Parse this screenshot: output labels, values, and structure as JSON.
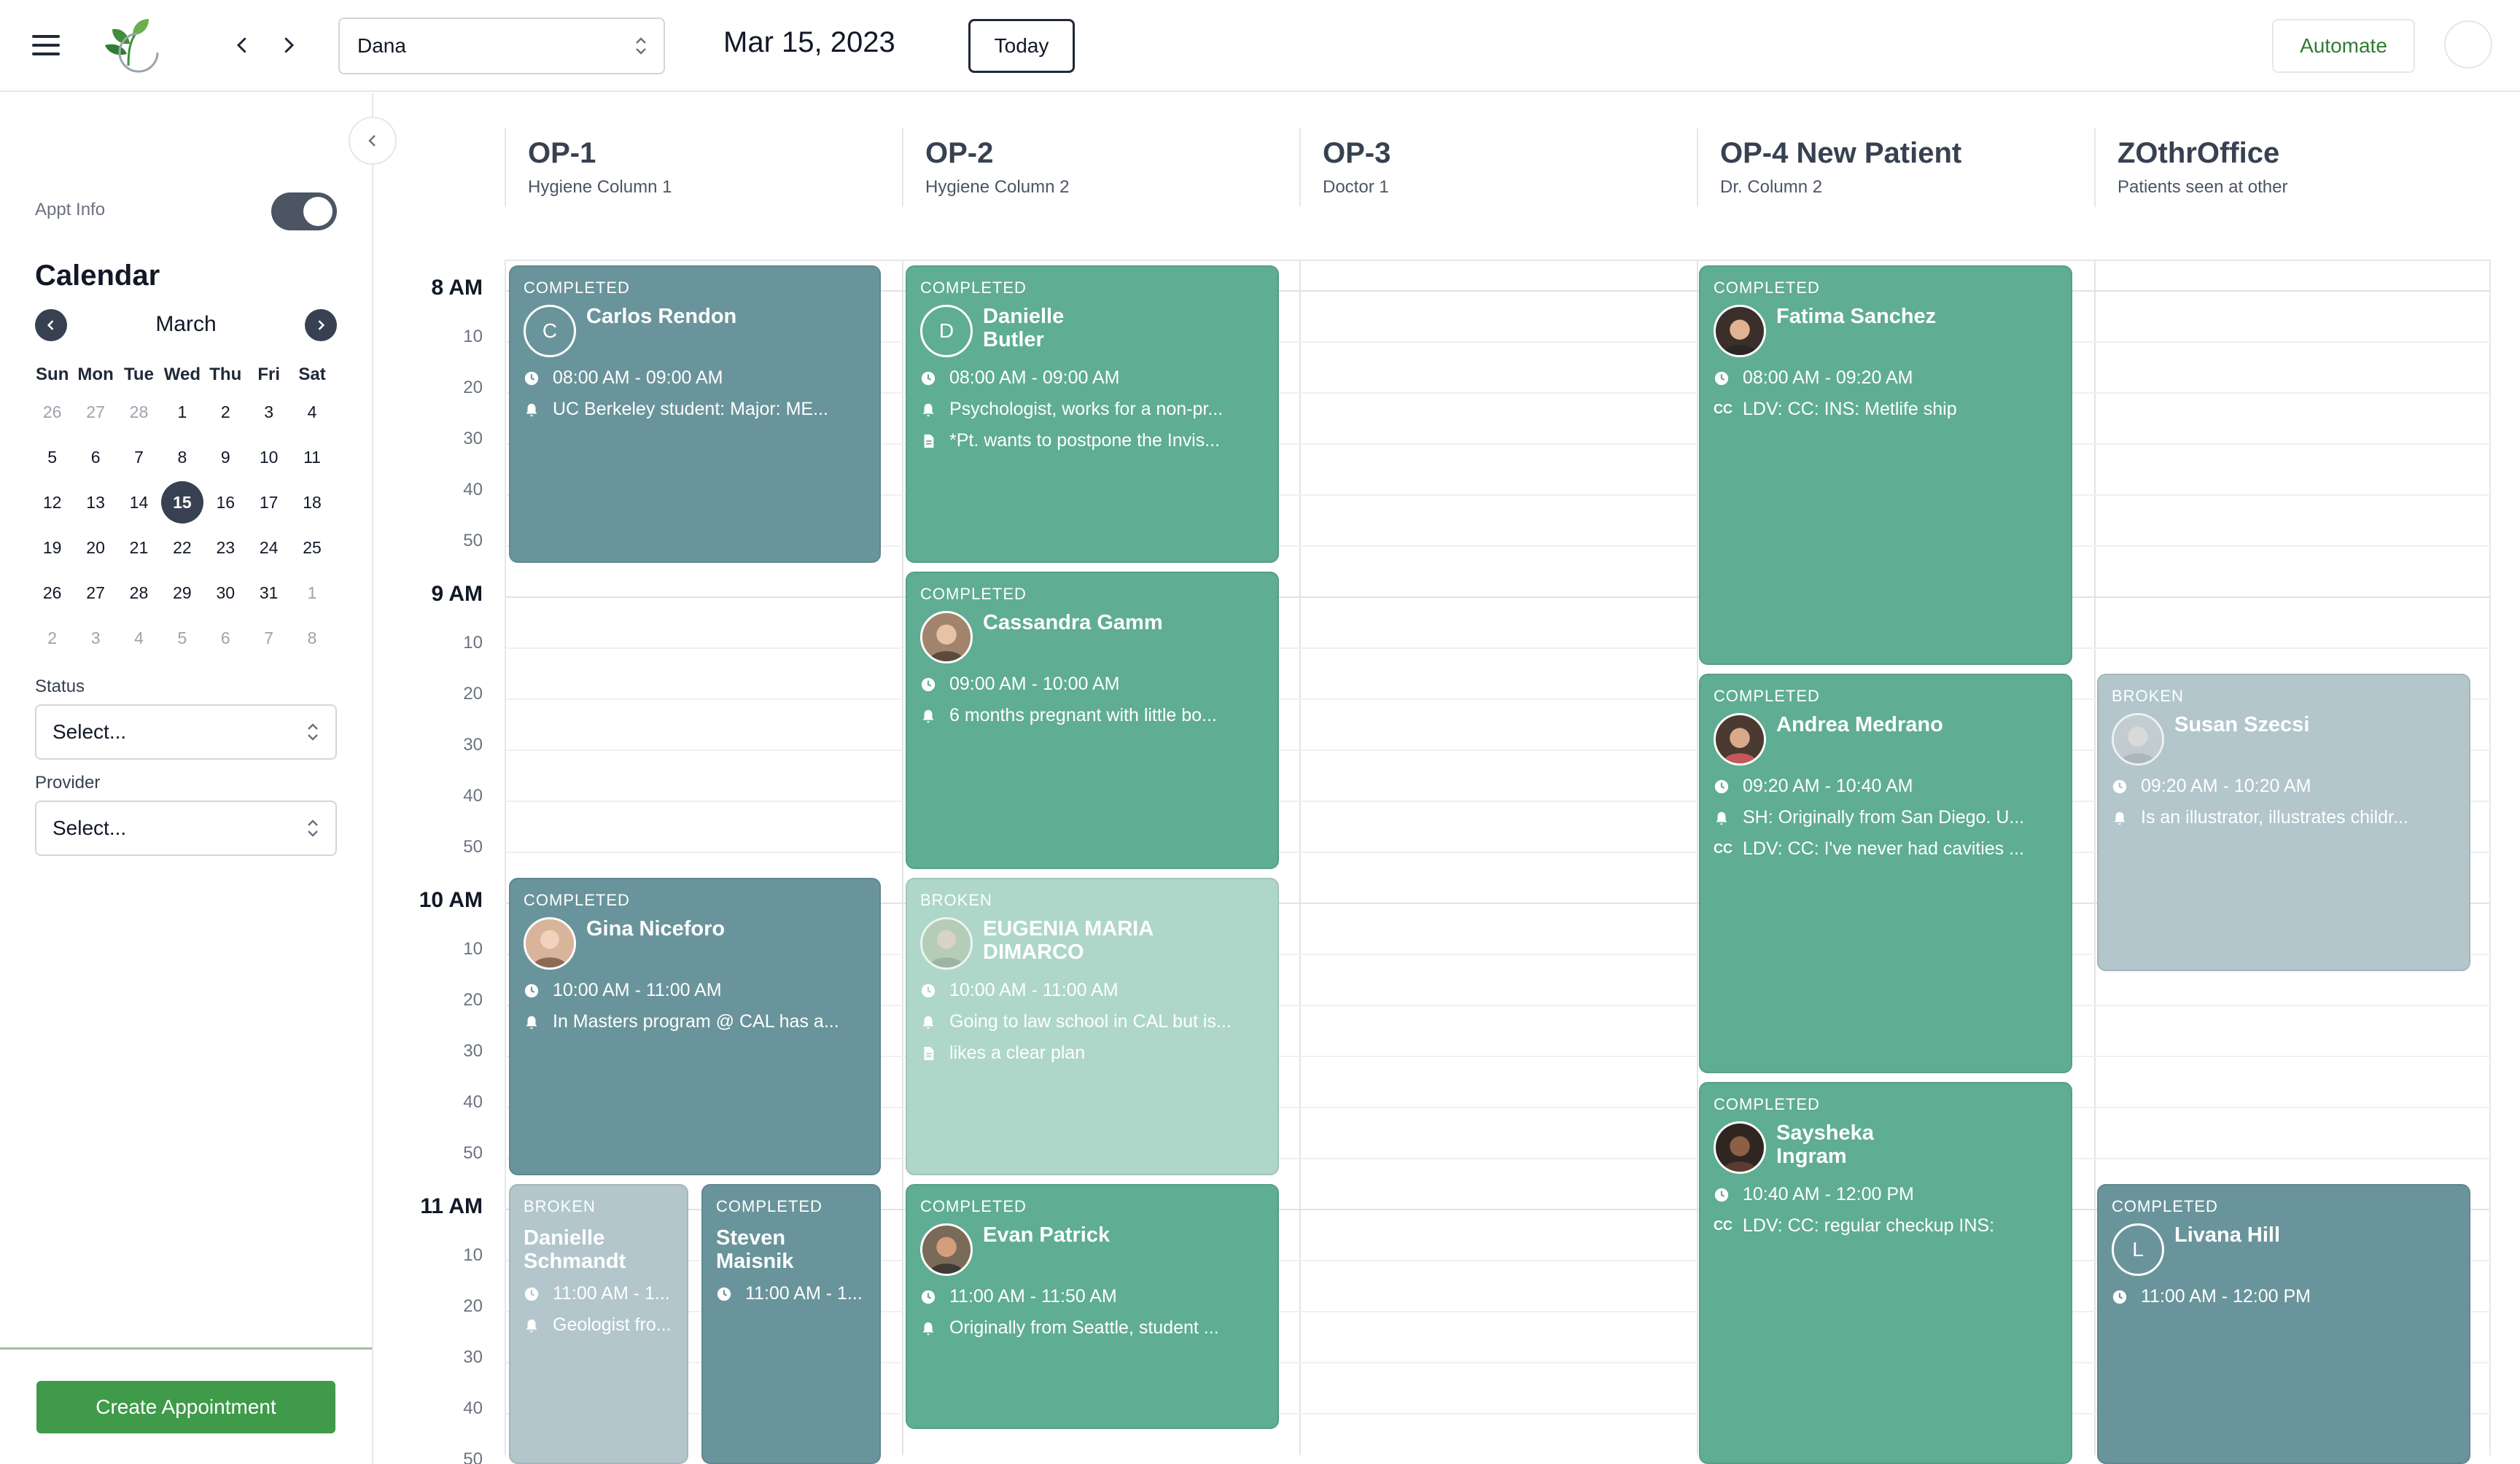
{
  "header": {
    "provider_value": "Dana",
    "date": "Mar 15, 2023",
    "today_label": "Today",
    "automate_label": "Automate"
  },
  "sidebar": {
    "appt_info_label": "Appt Info",
    "calendar_title": "Calendar",
    "month": "March",
    "weekdays": [
      "Sun",
      "Mon",
      "Tue",
      "Wed",
      "Thu",
      "Fri",
      "Sat"
    ],
    "weeks": [
      [
        "26",
        "27",
        "28",
        "1",
        "2",
        "3",
        "4"
      ],
      [
        "5",
        "6",
        "7",
        "8",
        "9",
        "10",
        "11"
      ],
      [
        "12",
        "13",
        "14",
        "15",
        "16",
        "17",
        "18"
      ],
      [
        "19",
        "20",
        "21",
        "22",
        "23",
        "24",
        "25"
      ],
      [
        "26",
        "27",
        "28",
        "29",
        "30",
        "31",
        "1"
      ],
      [
        "2",
        "3",
        "4",
        "5",
        "6",
        "7",
        "8"
      ]
    ],
    "selected_day": "15",
    "status_label": "Status",
    "status_placeholder": "Select...",
    "provider_label": "Provider",
    "provider_placeholder": "Select...",
    "create_label": "Create Appointment"
  },
  "columns": [
    {
      "title": "OP-1",
      "subtitle": "Hygiene Column 1"
    },
    {
      "title": "OP-2",
      "subtitle": "Hygiene Column 2"
    },
    {
      "title": "OP-3",
      "subtitle": "Doctor 1"
    },
    {
      "title": "OP-4 New Patient",
      "subtitle": "Dr. Column 2"
    },
    {
      "title": "ZOthrOffice",
      "subtitle": "Patients seen at other"
    }
  ],
  "time_labels": {
    "h8": "8 AM",
    "h9": "9 AM",
    "h10": "10 AM",
    "h11": "11 AM",
    "m10": "10",
    "m20": "20",
    "m30": "30",
    "m40": "40",
    "m50": "50"
  },
  "appointments": {
    "carlos": {
      "status": "COMPLETED",
      "initial": "C",
      "name": "Carlos Rendon",
      "time": "08:00 AM - 09:00 AM",
      "note": "UC Berkeley student: Major: ME..."
    },
    "danielle_b": {
      "status": "COMPLETED",
      "initial": "D",
      "name": "Danielle Butler",
      "time": "08:00 AM - 09:00 AM",
      "note": "Psychologist, works for a non-pr...",
      "doc": "*Pt. wants to postpone the Invis..."
    },
    "fatima": {
      "status": "COMPLETED",
      "name": "Fatima Sanchez",
      "time": "08:00 AM - 09:20 AM",
      "cc": "LDV: CC: INS: Metlife ship"
    },
    "cassandra": {
      "status": "COMPLETED",
      "name": "Cassandra Gamm",
      "time": "09:00 AM - 10:00 AM",
      "note": "6 months pregnant with little bo..."
    },
    "andrea": {
      "status": "COMPLETED",
      "name": "Andrea Medrano",
      "time": "09:20 AM - 10:40 AM",
      "note": "SH: Originally from San Diego. U...",
      "cc": "LDV: CC: I've never had cavities ..."
    },
    "susan": {
      "status": "BROKEN",
      "name": "Susan Szecsi",
      "time": "09:20 AM - 10:20 AM",
      "note": "Is an illustrator, illustrates childr..."
    },
    "gina": {
      "status": "COMPLETED",
      "name": "Gina Niceforo",
      "time": "10:00 AM - 11:00 AM",
      "note": "In Masters program @ CAL has a..."
    },
    "eugenia": {
      "status": "BROKEN",
      "name": "EUGENIA MARIA DIMARCO",
      "time": "10:00 AM - 11:00 AM",
      "note": "Going to law school in CAL but is...",
      "doc": "likes a clear plan"
    },
    "saysheka": {
      "status": "COMPLETED",
      "name": "Saysheka Ingram",
      "time": "10:40 AM - 12:00 PM",
      "cc": "LDV: CC: regular checkup INS:"
    },
    "danielle_s": {
      "status": "BROKEN",
      "name": "Danielle Schmandt",
      "time": "11:00 AM - 1...",
      "note": "Geologist fro..."
    },
    "steven": {
      "status": "COMPLETED",
      "name": "Steven Maisnik",
      "time": "11:00 AM - 1..."
    },
    "evan": {
      "status": "COMPLETED",
      "name": "Evan Patrick",
      "time": "11:00 AM - 11:50 AM",
      "note": "Originally from Seattle, student ..."
    },
    "livana": {
      "status": "COMPLETED",
      "initial": "L",
      "name": "Livana Hill",
      "time": "11:00 AM - 12:00 PM"
    }
  },
  "cc_badge": "CC",
  "colors": {
    "completed_green": "#5fad93",
    "completed_slate": "#69949b",
    "broken_green": "#aed7c9",
    "broken_slate": "#b2c6cc",
    "primary_button": "#3f9a4a",
    "automate_text": "#2e7d32"
  },
  "icons": [
    "menu-icon",
    "logo-leaf-icon",
    "chevron-left-icon",
    "chevron-right-icon",
    "select-arrows-icon",
    "clock-icon",
    "bell-icon",
    "document-icon"
  ]
}
